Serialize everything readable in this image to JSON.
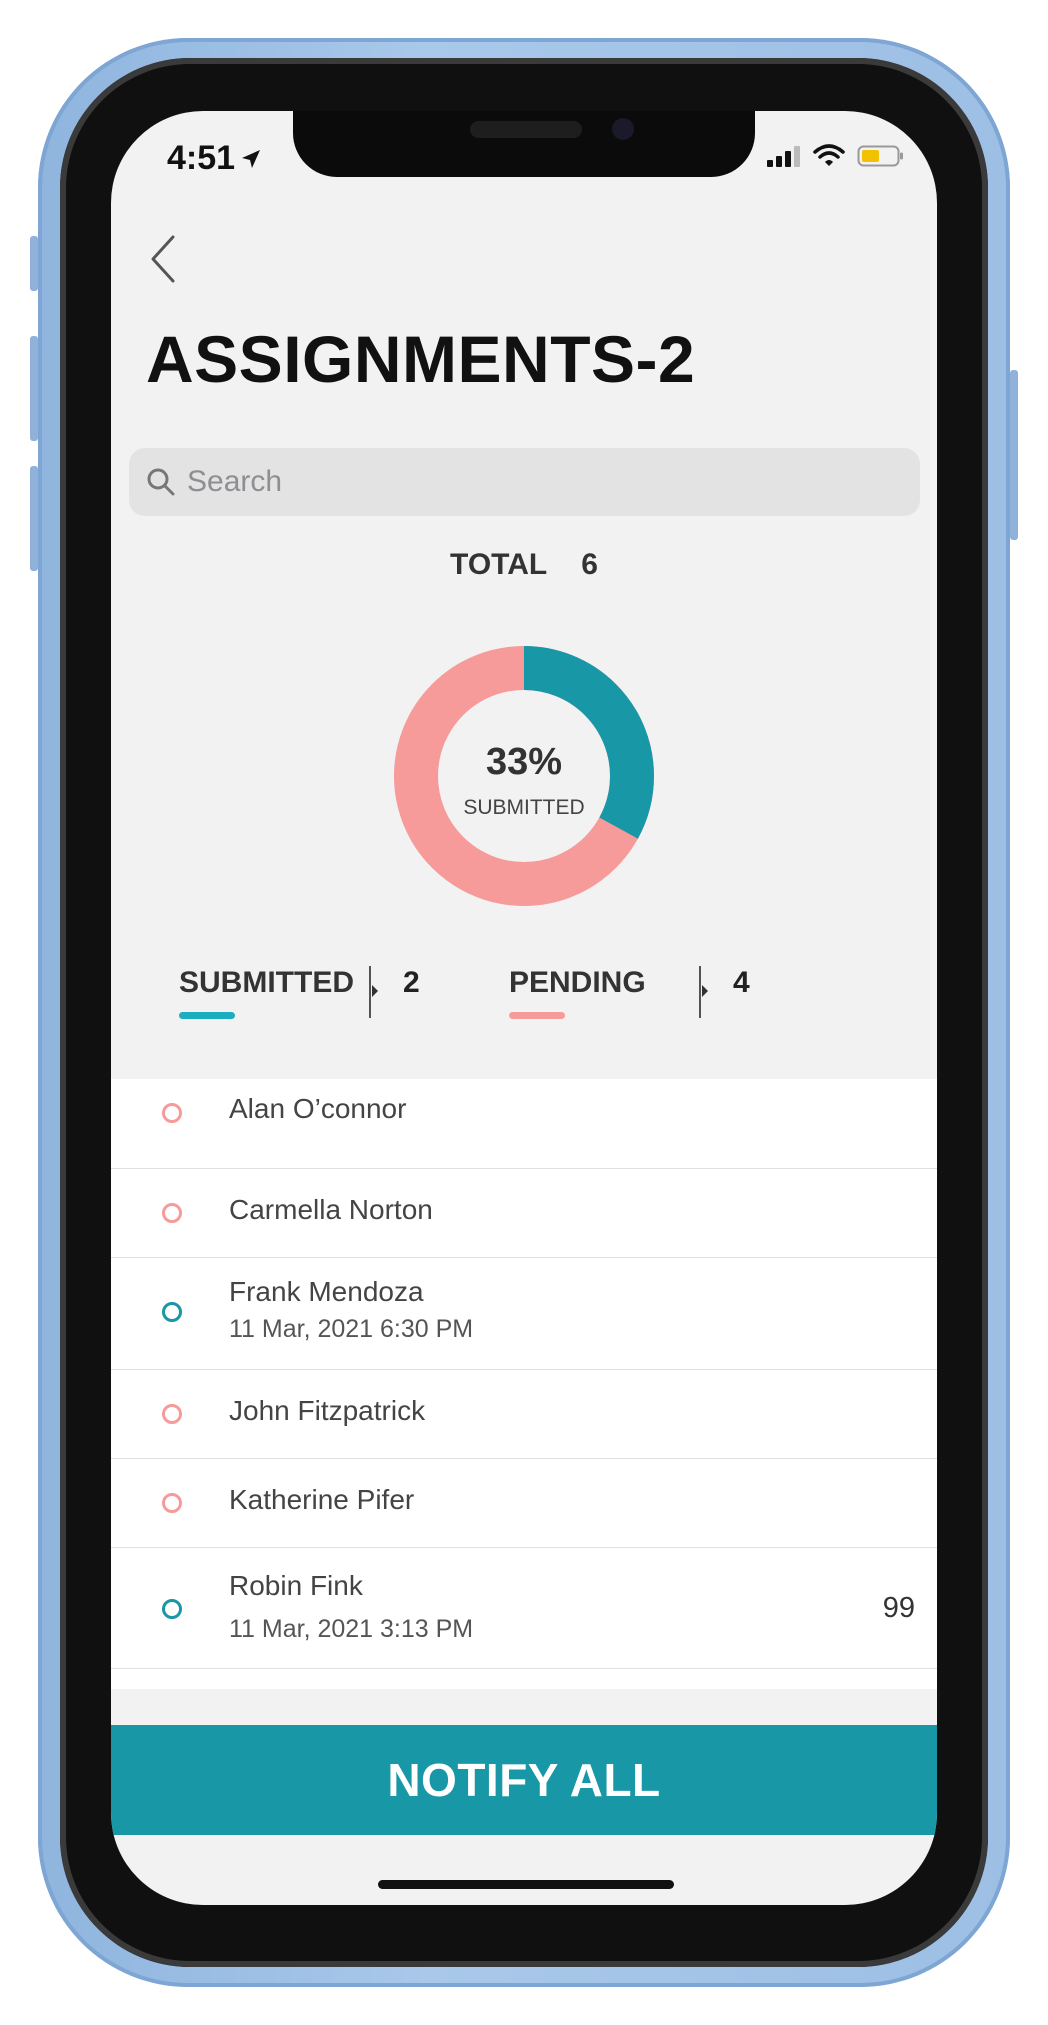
{
  "status_bar": {
    "time": "4:51"
  },
  "header": {
    "title": "ASSIGNMENTS-2"
  },
  "search": {
    "placeholder": "Search",
    "value": ""
  },
  "summary": {
    "total_label": "TOTAL",
    "total_value": "6",
    "percent_text": "33%",
    "percent_caption": "SUBMITTED",
    "submitted_fraction": 0.33,
    "colors": {
      "submitted": "#1897a6",
      "pending": "#f79a9a"
    }
  },
  "legend": {
    "submitted_label": "SUBMITTED",
    "submitted_count": "2",
    "pending_label": "PENDING",
    "pending_count": "4"
  },
  "students": [
    {
      "name": "Alan O’connor",
      "status": "pending",
      "date": "",
      "score": ""
    },
    {
      "name": "Carmella Norton",
      "status": "pending",
      "date": "",
      "score": ""
    },
    {
      "name": "Frank Mendoza",
      "status": "submitted",
      "date": "11 Mar, 2021 6:30 PM",
      "score": ""
    },
    {
      "name": "John Fitzpatrick",
      "status": "pending",
      "date": "",
      "score": ""
    },
    {
      "name": "Katherine Pifer",
      "status": "pending",
      "date": "",
      "score": ""
    },
    {
      "name": "Robin Fink",
      "status": "submitted",
      "date": "11 Mar, 2021 3:13 PM",
      "score": "99"
    }
  ],
  "footer": {
    "notify_label": "NOTIFY ALL"
  },
  "icons": {
    "back": "chevron-left-icon",
    "search": "search-icon",
    "location": "location-arrow-icon",
    "signal": "signal-icon",
    "wifi": "wifi-icon",
    "battery": "battery-icon"
  }
}
